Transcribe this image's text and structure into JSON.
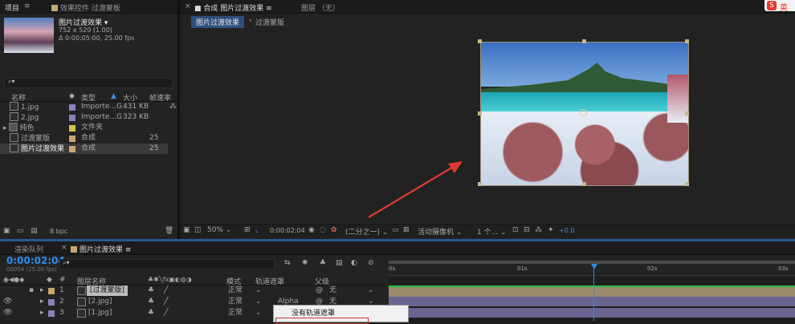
{
  "project_panel": {
    "tabs": [
      "项目",
      "效果控件 过渡蒙板"
    ],
    "selected_comp": {
      "name": "图片过渡效果",
      "dims": "752 x 520 (1.00)",
      "duration": "Δ 0:00:05:00, 25.00 fps"
    },
    "search_placeholder": "⌕▾",
    "columns": {
      "name": "名称",
      "type": "类型",
      "size": "大小",
      "rate": "帧速率"
    },
    "items": [
      {
        "name": "1.jpg",
        "color": "#8d7fb8",
        "type": "Importe...G",
        "size": "431 KB",
        "rate": ""
      },
      {
        "name": "2.jpg",
        "color": "#8d7fb8",
        "type": "Importe...G",
        "size": "323 KB",
        "rate": ""
      },
      {
        "name": "纯色",
        "color": "#d9c44a",
        "type": "文件夹",
        "size": "",
        "rate": ""
      },
      {
        "name": "过渡蒙版",
        "color": "#c7a86f",
        "type": "合成",
        "size": "",
        "rate": "25"
      },
      {
        "name": "图片过渡效果",
        "color": "#c7a86f",
        "type": "合成",
        "size": "",
        "rate": "25"
      }
    ],
    "bpc": "8 bpc"
  },
  "viewer": {
    "tabs": [
      "合成 图片过渡效果",
      "图层 （无）"
    ],
    "subtabs": [
      "图片过渡效果",
      "过渡蒙版"
    ],
    "zoom": "50%",
    "timecode": "0:00:02:04",
    "resolution": "(二分之一)",
    "camera": "活动摄像机",
    "views": "1 个...",
    "exposure": "+0.0"
  },
  "timeline": {
    "tabs": [
      "渲染队列",
      "图片过渡效果"
    ],
    "current_time": "0:00:02:04",
    "frame_info": "00054 (25.00 fps)",
    "search_placeholder": "⌕▾",
    "headers": {
      "num": "#",
      "layer_name": "图层名称",
      "mode": "模式",
      "track_matte": "轨道遮罩",
      "parent": "父级"
    },
    "layers": [
      {
        "num": "1",
        "name": "[过渡蒙版]",
        "color": "#c7a86f",
        "mode": "正常",
        "matte": "",
        "parent": "无"
      },
      {
        "num": "2",
        "name": "[2.jpg]",
        "color": "#8d7fb8",
        "mode": "正常",
        "matte": "Alpha",
        "parent": "无"
      },
      {
        "num": "3",
        "name": "[1.jpg]",
        "color": "#8d7fb8",
        "mode": "正常",
        "matte": "",
        "parent": "无"
      }
    ],
    "ruler": [
      "0s",
      "01s",
      "02s",
      "03s"
    ],
    "playhead_frac": 0.72
  },
  "context_menu": {
    "items": [
      "没有轨道遮罩"
    ]
  },
  "ime": {
    "label": "英"
  },
  "colors": {
    "accent": "#2d8ceb",
    "highlight_blue": "#3f8de0",
    "annotation_red": "#e03a32"
  }
}
